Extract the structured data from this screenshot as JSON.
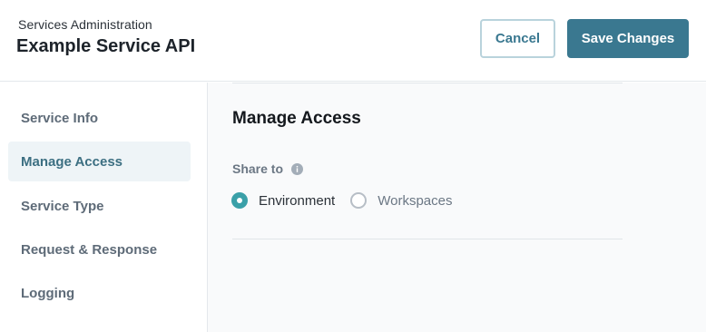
{
  "header": {
    "subtitle": "Services Administration",
    "title": "Example Service API",
    "cancel_label": "Cancel",
    "save_label": "Save Changes"
  },
  "sidebar": {
    "items": [
      {
        "label": "Service Info",
        "active": false
      },
      {
        "label": "Manage Access",
        "active": true
      },
      {
        "label": "Service Type",
        "active": false
      },
      {
        "label": "Request & Response",
        "active": false
      },
      {
        "label": "Logging",
        "active": false
      }
    ]
  },
  "main": {
    "section_title": "Manage Access",
    "share_label": "Share to",
    "share_info_icon": "info-icon",
    "options": [
      {
        "label": "Environment",
        "selected": true
      },
      {
        "label": "Workspaces",
        "selected": false
      }
    ]
  },
  "colors": {
    "primary": "#3a7890",
    "radio_checked": "#3aa0a8",
    "active_nav_bg": "#eef4f7"
  }
}
